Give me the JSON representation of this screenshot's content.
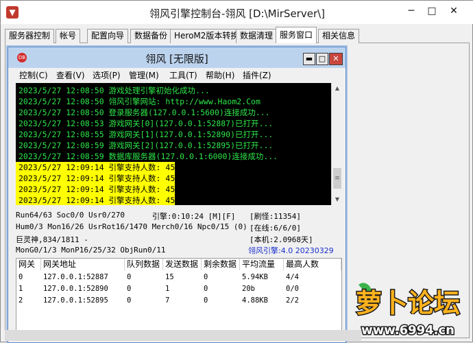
{
  "window": {
    "title": "翎风引擎控制台-翎风 [D:\\MirServer\\]",
    "minimize": "─",
    "maximize": "□",
    "close": "✕"
  },
  "tabs": [
    {
      "label": "服务器控制",
      "active": false
    },
    {
      "label": "帐号",
      "active": false
    },
    {
      "label": "配置向导",
      "active": false
    },
    {
      "label": "数据备份",
      "active": false
    },
    {
      "label": "HeroM2版本转换",
      "active": false
    },
    {
      "label": "数据清理",
      "active": false
    },
    {
      "label": "服务窗口",
      "active": true
    },
    {
      "label": "相关信息",
      "active": false
    }
  ],
  "child": {
    "icon_text": "DB",
    "title": "翎风 [无限版]",
    "minimize": "▬",
    "maximize": "□",
    "close": "✕",
    "menu": [
      "控制(C)",
      "查看(V)",
      "选项(P)",
      "管理(M)",
      "工具(T)",
      "帮助(H)",
      "插件(Z)"
    ]
  },
  "log": [
    {
      "text": "2023/5/27 12:08:50 游戏处理引擎初始化成功...",
      "highlight": false
    },
    {
      "text": "2023/5/27 12:08:50 翎风引擎网站: http://www.Haom2.Com",
      "highlight": false
    },
    {
      "text": "2023/5/27 12:08:50 登录服务器(127.0.0.1:5600)连接成功...",
      "highlight": false
    },
    {
      "text": "2023/5/27 12:08:53 游戏网关[0](127.0.0.1:52887)已打开...",
      "highlight": false
    },
    {
      "text": "2023/5/27 12:08:55 游戏网关[1](127.0.0.1:52890)已打开...",
      "highlight": false
    },
    {
      "text": "2023/5/27 12:08:59 游戏网关[2](127.0.0.1:52895)已打开...",
      "highlight": false
    },
    {
      "text": "2023/5/27 12:08:59 数据库服务器(127.0.0.1:6000)连接成功...",
      "highlight": false
    },
    {
      "text": "2023/5/27 12:09:14 引擎支持人数: 45",
      "highlight": true
    },
    {
      "text": "2023/5/27 12:09:14 引擎支持人数: 45",
      "highlight": true
    },
    {
      "text": "2023/5/27 12:09:14 引擎支持人数: 45",
      "highlight": true
    },
    {
      "text": "2023/5/27 12:09:14 引擎支持人数: 45",
      "highlight": true
    }
  ],
  "scroll": {
    "up": "▲",
    "down": "▼",
    "thumb": "≡"
  },
  "status": {
    "run": "Run64/63 Soc0/0 Usr0/270",
    "engine_time": "引擎:0:10:24 [M][F]",
    "refresh": "[刷怪:11354]",
    "hum": "Hum0/3 Mon16/26 UsrRot16/1470 Merch0/16 Npc0/15 (0)",
    "online": "[在线:6/6/0]",
    "giant": "巨灵神,834/1811 -",
    "local": "[本机:2.0968天]",
    "mon": "MonG0/1/3 MonP16/25/32 ObjRun0/11",
    "version": "翎风引擎:4.0 20230329"
  },
  "gateway_table": {
    "columns": [
      "网关",
      "网关地址",
      "队列数据",
      "发送数据",
      "剩余数据",
      "平均流量",
      "最高人数"
    ],
    "rows": [
      [
        "0",
        "127.0.0.1:52887",
        "0",
        "15",
        "0",
        "5.94KB",
        "4/4"
      ],
      [
        "1",
        "127.0.0.1:52890",
        "0",
        "1",
        "0",
        "20b",
        "0/0"
      ],
      [
        "2",
        "127.0.0.1:52895",
        "0",
        "7",
        "0",
        "4.88KB",
        "2/2"
      ]
    ]
  },
  "watermark": {
    "brand": "萝卜论坛",
    "url": "www.6994.cn"
  },
  "colors": {
    "log_bg": "#000000",
    "log_text": "#2ee64a",
    "log_highlight": "#ffff00",
    "version_text": "#1a2fcc",
    "child_title_bg": "#bcd3ee"
  }
}
